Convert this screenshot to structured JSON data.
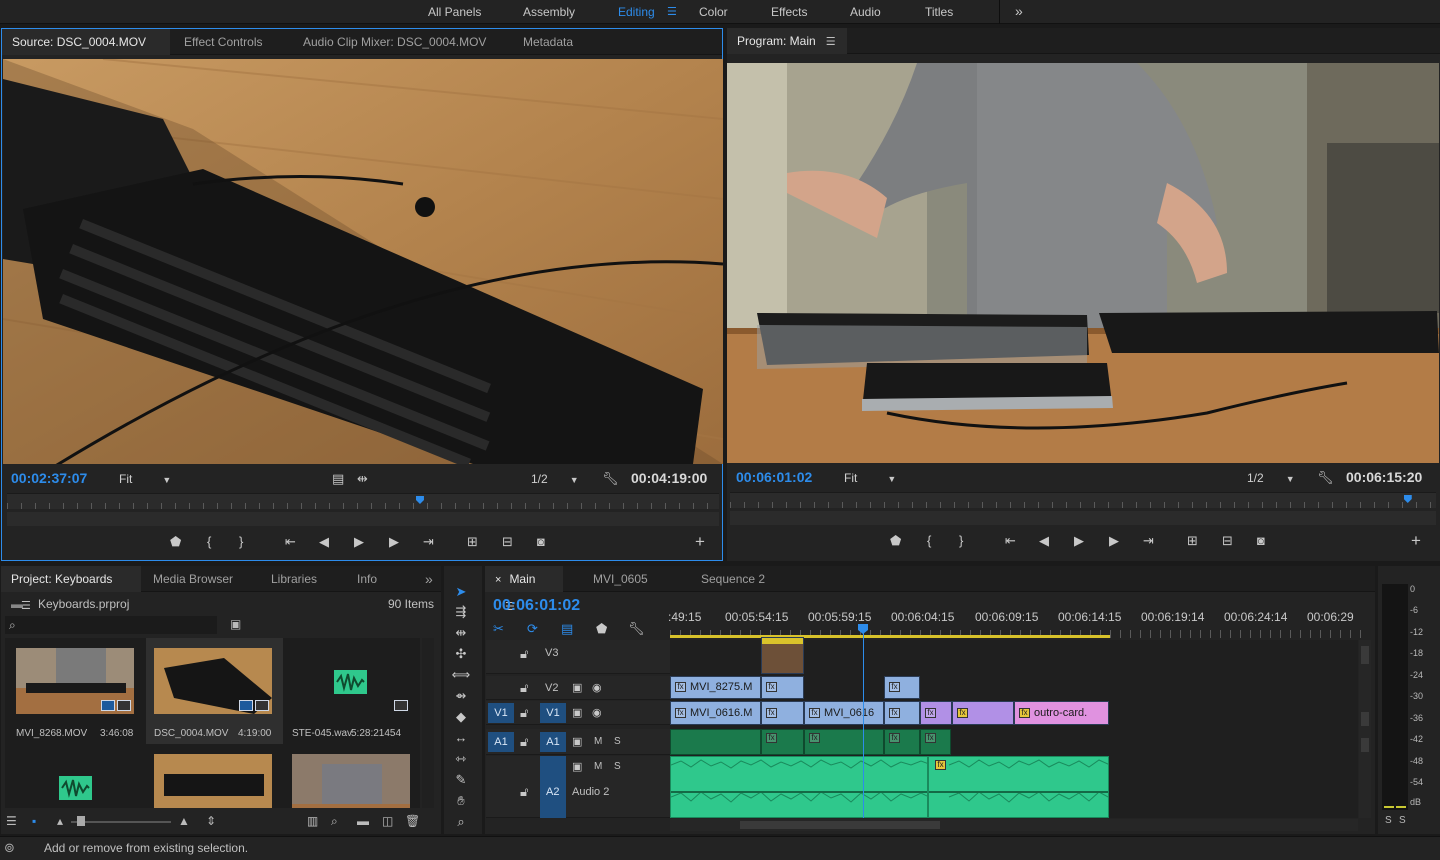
{
  "workspaces": [
    "All Panels",
    "Assembly",
    "Editing",
    "Color",
    "Effects",
    "Audio",
    "Titles"
  ],
  "workspace_overflow": "»",
  "source_panel": {
    "tabs": [
      "Source: DSC_0004.MOV",
      "Effect Controls",
      "Audio Clip Mixer: DSC_0004.MOV",
      "Metadata"
    ],
    "timecode_in": "00:02:37:07",
    "zoom": "Fit",
    "resolution": "1/2",
    "duration": "00:04:19:00",
    "playhead_fraction": 0.58
  },
  "program_panel": {
    "title": "Program: Main",
    "timecode": "00:06:01:02",
    "zoom": "Fit",
    "resolution": "1/2",
    "duration": "00:06:15:20",
    "playhead_fraction": 0.96
  },
  "transport_icons": [
    "marker-icon",
    "mark-in-icon",
    "mark-out-icon",
    "go-to-in-icon",
    "step-back-icon",
    "play-icon",
    "step-forward-icon",
    "go-to-out-icon",
    "insert-icon",
    "overwrite-icon",
    "export-frame-icon",
    "add-button-icon"
  ],
  "project_panel": {
    "tabs": [
      "Project: Keyboards",
      "Media Browser",
      "Libraries",
      "Info"
    ],
    "project_file": "Keyboards.prproj",
    "item_count": "90 Items",
    "items": [
      {
        "name": "MVI_8268.MOV",
        "duration": "3:46:08"
      },
      {
        "name": "DSC_0004.MOV",
        "duration": "4:19:00"
      },
      {
        "name": "STE-045.wav",
        "duration": "5:28:21454"
      }
    ]
  },
  "timeline": {
    "tabs": [
      "Main",
      "MVI_0605",
      "Sequence 2"
    ],
    "timecode": "00:06:01:02",
    "ruler": [
      ":49:15",
      "00:05:54:15",
      "00:05:59:15",
      "00:06:04:15",
      "00:06:09:15",
      "00:06:14:15",
      "00:06:19:14",
      "00:06:24:14",
      "00:06:29"
    ],
    "tracks": {
      "v3": "V3",
      "v2": "V2",
      "v1_src": "V1",
      "v1": "V1",
      "a1_src": "A1",
      "a1": "A1",
      "a2": "A2",
      "a2_name": "Audio 2",
      "m": "M",
      "s": "S"
    },
    "clips": {
      "v2a": "MVI_8275.M",
      "v1a": "MVI_0616.M",
      "v1b": "MVI_0616",
      "v1c": "outro-card.",
      "fx": "fx"
    }
  },
  "meter_scale": [
    "0",
    "-6",
    "-12",
    "-18",
    "-24",
    "-30",
    "-36",
    "-42",
    "-48",
    "-54",
    "dB"
  ],
  "meter_solo": [
    "S",
    "S"
  ],
  "status_text": "Add or remove from existing selection."
}
